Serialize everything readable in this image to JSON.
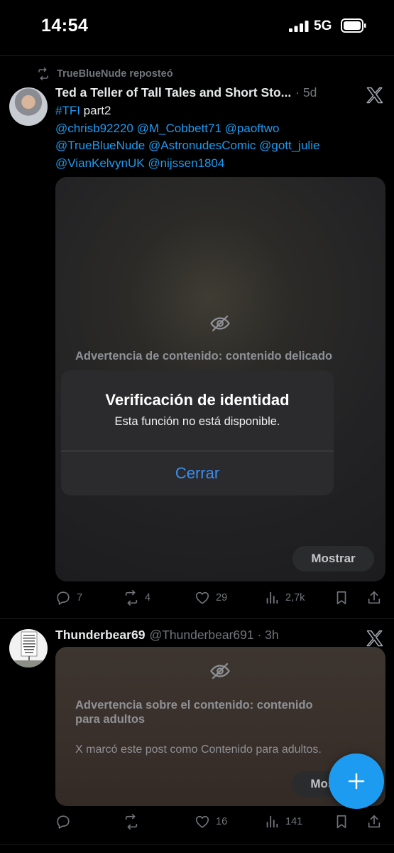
{
  "status_bar": {
    "time": "14:54",
    "network": "5G"
  },
  "post1": {
    "repost_label": "TrueBlueNude reposteó",
    "author_name": "Ted a Teller of Tall Tales and Short Sto...",
    "meta": "· 5d",
    "text_lines": [
      {
        "tag": "#TFI",
        "rest": " part2"
      },
      {
        "tag": "@chrisb92220 @M_Cobbett71 @paoftwo",
        "rest": ""
      },
      {
        "tag": "@TrueBlueNude @AstronudesComic @gott_julie",
        "rest": ""
      },
      {
        "tag": "@VianKelvynUK @nijssen1804",
        "rest": ""
      }
    ],
    "warning_title": "Advertencia de contenido: contenido delicado",
    "show_label": "Mostrar",
    "actions": {
      "replies": "7",
      "reposts": "4",
      "likes": "29",
      "views": "2,7k"
    }
  },
  "dialog": {
    "title": "Verificación de identidad",
    "message": "Esta función no está disponible.",
    "close_label": "Cerrar"
  },
  "post2": {
    "author_name": "Thunderbear69",
    "meta": "@Thunderbear691 · 3h",
    "warning_title_line1": "Advertencia sobre el contenido: contenido",
    "warning_title_line2": "para adultos",
    "warning_desc": "X marcó este post como Contenido para adultos.",
    "show_label": "Mostrar",
    "actions": {
      "replies": "",
      "reposts": "",
      "likes": "16",
      "views": "141"
    }
  },
  "colors": {
    "accent": "#1d9bf0",
    "dialog_button": "#3a8ef0",
    "muted": "#71767b",
    "background": "#000000"
  },
  "icons": [
    "repost-icon",
    "x-logo-icon",
    "hidden-eye-icon",
    "reply-icon",
    "like-icon",
    "views-icon",
    "bookmark-icon",
    "share-icon",
    "compose-plus-icon"
  ]
}
